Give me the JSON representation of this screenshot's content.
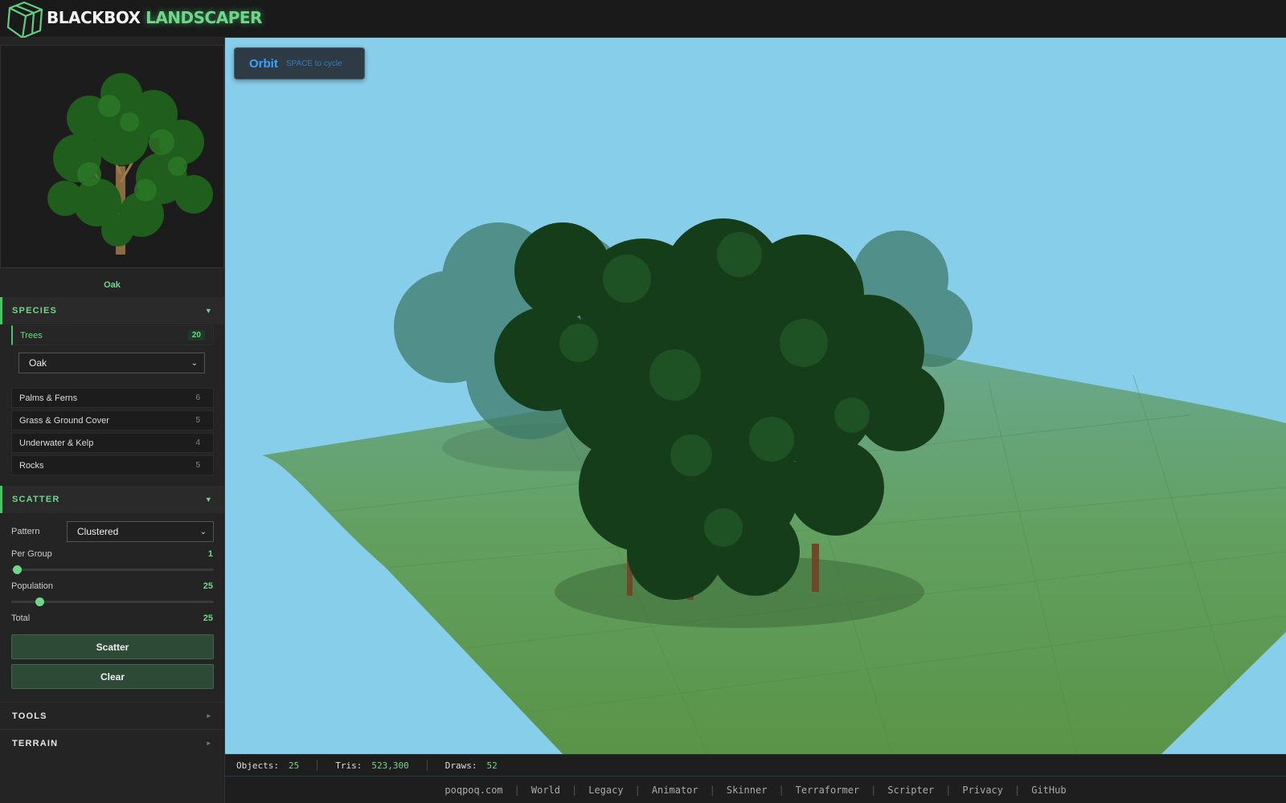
{
  "header": {
    "brand_part1": "BLACKBOX",
    "brand_part2": "LANDSCAPER"
  },
  "sidebar": {
    "preview_name": "Oak",
    "species": {
      "title": "SPECIES",
      "categories": [
        {
          "label": "Trees",
          "count": "20",
          "active": true
        },
        {
          "label": "Palms & Ferns",
          "count": "6"
        },
        {
          "label": "Grass & Ground Cover",
          "count": "5"
        },
        {
          "label": "Underwater & Kelp",
          "count": "4"
        },
        {
          "label": "Rocks",
          "count": "5"
        }
      ],
      "tree_select": "Oak"
    },
    "scatter": {
      "title": "SCATTER",
      "pattern_label": "Pattern",
      "pattern_value": "Clustered",
      "per_group_label": "Per Group",
      "per_group_value": "1",
      "population_label": "Population",
      "population_value": "25",
      "total_label": "Total",
      "total_value": "25",
      "scatter_button": "Scatter",
      "clear_button": "Clear"
    },
    "tools_title": "TOOLS",
    "terrain_title": "TERRAIN"
  },
  "viewport": {
    "mode": "Orbit",
    "hint": "SPACE to cycle"
  },
  "stats": {
    "objects_label": "Objects:",
    "objects": "25",
    "tris_label": "Tris:",
    "tris": "523,300",
    "draws_label": "Draws:",
    "draws": "52"
  },
  "footer": {
    "links": [
      "poqpoq.com",
      "World",
      "Legacy",
      "Animator",
      "Skinner",
      "Terraformer",
      "Scripter",
      "Privacy",
      "GitHub"
    ]
  },
  "colors": {
    "accent": "#6fd68a",
    "sky": "#87ceeb",
    "ground": "#5e9a50",
    "mode_blue": "#3aa3ff"
  }
}
